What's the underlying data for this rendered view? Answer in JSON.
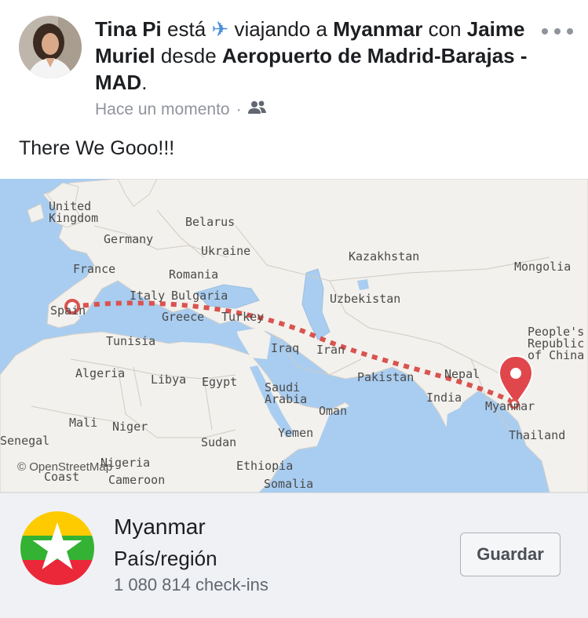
{
  "post": {
    "author": "Tina Pi",
    "verb": "está",
    "activity_icon": "airplane-icon",
    "activity": "viajando a",
    "destination": "Myanmar",
    "with_word": "con",
    "companion": "Jaime Muriel",
    "from_word": "desde",
    "origin": "Aeropuerto de Madrid-Barajas - MAD",
    "end_punct": ".",
    "timestamp": "Hace un momento",
    "separator": "·",
    "audience_icon": "friends-icon",
    "text": "There We Gooo!!!"
  },
  "map": {
    "attribution": "© OpenStreetMap",
    "route_color": "#d9534f",
    "labels": {
      "uk": "United\nKingdom",
      "belarus": "Belarus",
      "germany": "Germany",
      "ukraine": "Ukraine",
      "kazakhstan": "Kazakhstan",
      "mongolia": "Mongolia",
      "france": "France",
      "romania": "Romania",
      "italy": "Italy",
      "bulgaria": "Bulgaria",
      "uzbekistan": "Uzbekistan",
      "spain": "Spain",
      "greece": "Greece",
      "turkey": "Turkey",
      "china": "People's\nRepublic\nof China",
      "tunisia": "Tunisia",
      "iraq": "Iraq",
      "iran": "Iran",
      "algeria": "Algeria",
      "libya": "Libya",
      "egypt": "Egypt",
      "pakistan": "Pakistan",
      "nepal": "Nepal",
      "saudi": "Saudi\nArabia",
      "india": "India",
      "myanmar": "Myanmar",
      "oman": "Oman",
      "mali": "Mali",
      "niger": "Niger",
      "thailand": "Thailand",
      "yemen": "Yemen",
      "senegal": "Senegal",
      "sudan": "Sudan",
      "nigeria": "Nigeria",
      "coast": "Coast",
      "ethiopia": "Ethiopia",
      "cameroon": "Cameroon",
      "somalia": "Somalia"
    }
  },
  "place": {
    "name": "Myanmar",
    "type": "País/región",
    "checkins": "1 080 814 check-ins",
    "save_label": "Guardar",
    "flag_colors": [
      "#fecb00",
      "#34b233",
      "#ea2839"
    ]
  }
}
